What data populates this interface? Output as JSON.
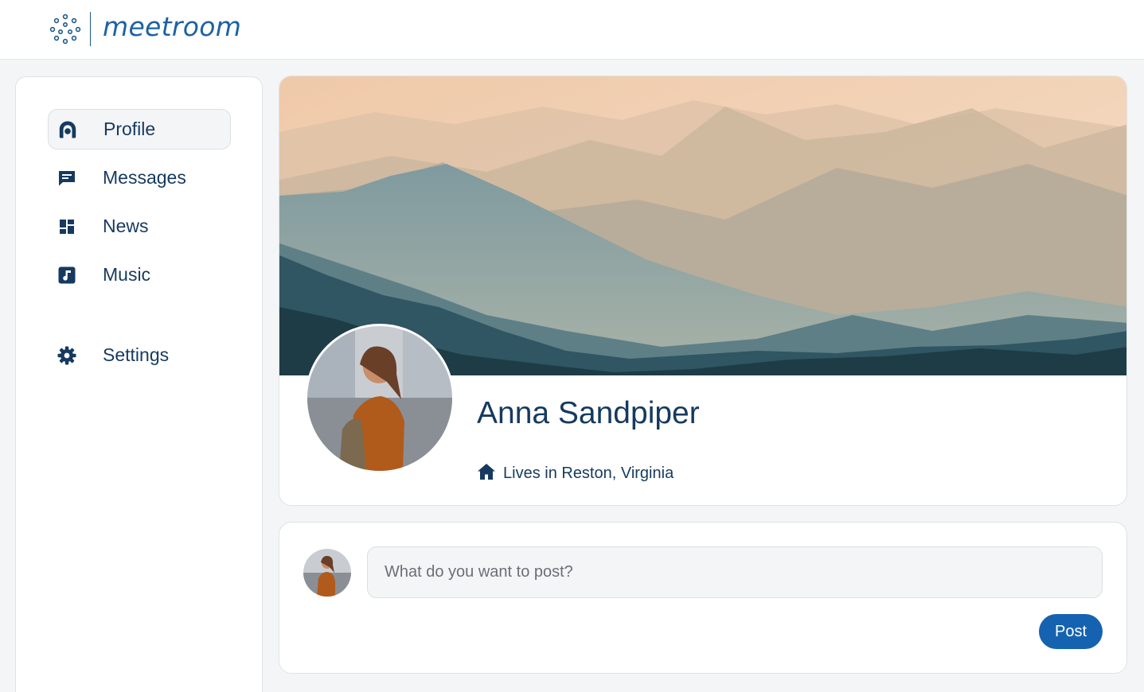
{
  "app": {
    "brand": "meetroom"
  },
  "colors": {
    "primary": "#1563b0",
    "navy": "#163a5f",
    "page_bg": "#f4f5f7"
  },
  "sidebar": {
    "items": [
      {
        "label": "Profile",
        "icon": "user-icon",
        "active": true
      },
      {
        "label": "Messages",
        "icon": "message-icon",
        "active": false
      },
      {
        "label": "News",
        "icon": "dashboard-icon",
        "active": false
      },
      {
        "label": "Music",
        "icon": "music-note-icon",
        "active": false
      },
      {
        "label": "Settings",
        "icon": "gear-icon",
        "active": false
      }
    ]
  },
  "profile": {
    "name": "Anna Sandpiper",
    "location": "Lives in Reston, Virginia",
    "location_icon": "home-icon",
    "cover": "mountain-landscape"
  },
  "composer": {
    "placeholder": "What do you want to post?",
    "value": "",
    "button_label": "Post"
  }
}
